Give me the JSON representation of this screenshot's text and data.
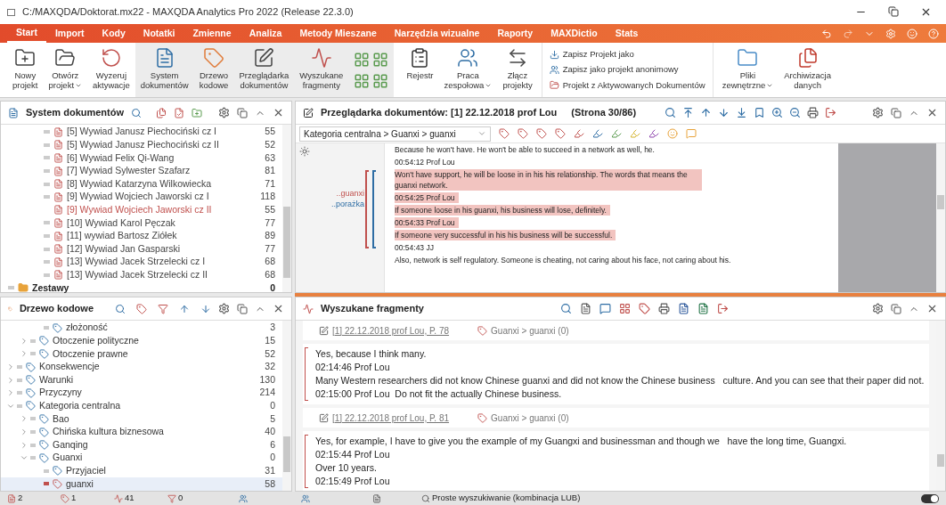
{
  "window": {
    "title": "C:/MAXQDA/Doktorat.mx22 - MAXQDA Analytics Pro 2022 (Release 22.3.0)"
  },
  "menu_tabs": [
    {
      "label": "Start",
      "selected": true
    },
    {
      "label": "Import",
      "selected": false
    },
    {
      "label": "Kody",
      "selected": false
    },
    {
      "label": "Notatki",
      "selected": false
    },
    {
      "label": "Zmienne",
      "selected": false
    },
    {
      "label": "Analiza",
      "selected": false
    },
    {
      "label": "Metody Mieszane",
      "selected": false
    },
    {
      "label": "Narzędzia wizualne",
      "selected": false
    },
    {
      "label": "Raporty",
      "selected": false
    },
    {
      "label": "MAXDictio",
      "selected": false
    },
    {
      "label": "Stats",
      "selected": false
    }
  ],
  "ribbon": [
    {
      "kind": "big",
      "label": "Nowy\nprojekt",
      "on": false,
      "dropdown": false
    },
    {
      "kind": "big",
      "label": "Otwórz\nprojekt",
      "on": false,
      "dropdown": true
    },
    {
      "kind": "big",
      "label": "Wyzeruj\naktywacje",
      "on": false,
      "dropdown": false
    },
    {
      "kind": "big",
      "label": "System\ndokumentów",
      "on": true,
      "dropdown": false
    },
    {
      "kind": "big",
      "label": "Drzewo\nkodowe",
      "on": true,
      "dropdown": false
    },
    {
      "kind": "big",
      "label": "Przeglądarka\ndokumentów",
      "on": true,
      "dropdown": false
    },
    {
      "kind": "big",
      "label": "Wyszukane\nfragmenty",
      "on": true,
      "dropdown": false
    },
    {
      "kind": "layout"
    },
    {
      "kind": "big",
      "label": "Rejestr",
      "on": false,
      "dropdown": false
    },
    {
      "kind": "big",
      "label": "Praca\nzespołowa",
      "on": false,
      "dropdown": true
    },
    {
      "kind": "big",
      "label": "Złącz\nprojekty",
      "on": false,
      "dropdown": false
    },
    {
      "kind": "stack",
      "items": [
        "Zapisz Projekt jako",
        "Zapisz jako projekt anonimowy",
        "Projekt z Aktywowanych Dokumentów"
      ]
    },
    {
      "kind": "big",
      "label": "Pliki\nzewnętrzne",
      "on": false,
      "dropdown": true
    },
    {
      "kind": "big",
      "label": "Archiwizacja\ndanych",
      "on": false,
      "dropdown": false
    }
  ],
  "document_system": {
    "title": "System dokumentów",
    "tree": [
      {
        "children": [
          {
            "children": [
              {
                "label": "[5] Wywiad Janusz Piechociński cz I",
                "count": "55",
                "selected": false
              },
              {
                "label": "[5] Wywiad Janusz Piechociński cz II",
                "count": "52",
                "selected": false
              },
              {
                "label": "[6] Wywiad Felix Qi-Wang",
                "count": "63",
                "selected": false
              },
              {
                "label": "[7] Wywiad Sylwester Szafarz",
                "count": "81",
                "selected": false
              },
              {
                "label": "[8] Wywiad Katarzyna Wilkowiecka",
                "count": "71",
                "selected": false
              },
              {
                "label": "[9] Wywiad Wojciech Jaworski cz I",
                "count": "118",
                "selected": false
              },
              {
                "label": "[9] Wywiad Wojciech Jaworski cz II",
                "count": "55",
                "selected": true
              },
              {
                "label": "[10] Wywiad Karol Pęczak",
                "count": "77",
                "selected": false
              },
              {
                "label": "[11] wywiad Bartosz Ziółek",
                "count": "89",
                "selected": false
              },
              {
                "label": "[12] Wywiad Jan Gasparski",
                "count": "77",
                "selected": false
              },
              {
                "label": "[13] Wywiad Jacek Strzelecki cz I",
                "count": "68",
                "selected": false
              },
              {
                "label": "[13] Wywiad Jacek Strzelecki  cz II",
                "count": "68",
                "selected": false
              }
            ]
          }
        ]
      },
      {
        "label": "Zestawy",
        "count": "0",
        "kind": "sets"
      }
    ]
  },
  "code_system": {
    "title": "Drzewo kodowe",
    "tree": [
      {
        "children": [
          {
            "children": [
              {
                "label": "złożoność",
                "count": "3"
              }
            ]
          },
          {
            "label": "Otoczenie polityczne",
            "count": "15",
            "expanded": false
          },
          {
            "label": "Otoczenie prawne",
            "count": "52",
            "expanded": false
          }
        ]
      },
      {
        "label": "Konsekwencje",
        "count": "32",
        "expanded": false
      },
      {
        "label": "Warunki",
        "count": "130",
        "expanded": false
      },
      {
        "label": "Przyczyny",
        "count": "214",
        "expanded": false
      },
      {
        "label": "Kategoria centralna",
        "count": "0",
        "expanded": true,
        "children": [
          {
            "label": "Bao",
            "count": "5",
            "expanded": false
          },
          {
            "label": "Chińska kultura biznesowa",
            "count": "40",
            "expanded": false
          },
          {
            "label": "Ganqing",
            "count": "6",
            "expanded": false
          },
          {
            "label": "Guanxi",
            "count": "0",
            "expanded": true,
            "children": [
              {
                "label": "Przyjaciel",
                "count": "31",
                "selected": false
              },
              {
                "label": "guanxi",
                "count": "58",
                "selected": true
              }
            ]
          }
        ]
      }
    ]
  },
  "document_browser": {
    "title": "Przeglądarka dokumentów: [1] 22.12.2018 prof Lou",
    "page": "(Strona 30/86)",
    "code_path": "Kategoria centralna > Guanxi > guanxi",
    "margin_codes": [
      {
        "label": "..guanxi",
        "color": "#c0504d"
      },
      {
        "label": "..porażka",
        "color": "#2e6da4"
      }
    ],
    "paragraphs": [
      {
        "text": "Because he won't have. He won't be able to succeed in a network as well, he.",
        "coded": false
      },
      {
        "text": "00:54:12 Prof Lou",
        "coded": false
      },
      {
        "text": "Won't have support, he will be loose in in his his relationship. The words that means the guanxi network.",
        "coded": true
      },
      {
        "text": "00:54:25 Prof Lou",
        "coded": true
      },
      {
        "text": "If someone loose in his guanxi, his business will lose, definitely.",
        "coded": true
      },
      {
        "text": "00:54:33 Prof Lou",
        "coded": true
      },
      {
        "text": "If someone very successful in his his business will be successful.",
        "coded": true
      },
      {
        "text": "00:54:43 JJ",
        "coded": false
      },
      {
        "text": "Also, network is self regulatory. Someone is cheating, not caring about his face, not caring about his.",
        "coded": false
      }
    ]
  },
  "retrieved_segments": {
    "title": "Wyszukane fragmenty",
    "segments": [
      {
        "source": "[1] 22.12.2018 prof Lou, P. 78",
        "code": "Guanxi > guanxi (0)",
        "lines": [
          "Yes, because I think many.",
          "02:14:46 Prof Lou",
          "Many Western researchers did not know Chinese guanxi and did not know the Chinese business   culture. And you can see that their paper did not.",
          "02:15:00 Prof Lou  Do not fit the actually Chinese business."
        ]
      },
      {
        "source": "[1] 22.12.2018 prof Lou, P. 81",
        "code": "Guanxi > guanxi (0)",
        "lines": [
          "Yes, for example, I have to give you the example of my Guangxi and businessman and though we   have the long time, Guangxi.",
          "02:15:44 Prof Lou",
          "Over 10 years.",
          "02:15:49 Prof Lou"
        ]
      }
    ]
  },
  "status_bar": {
    "counts": [
      {
        "kind": "documents",
        "value": "2"
      },
      {
        "kind": "codes",
        "value": "1"
      },
      {
        "kind": "segments",
        "value": "41"
      },
      {
        "kind": "weights",
        "value": "0"
      }
    ],
    "search_mode": "Proste wyszukiwanie (kombinacja LUB)",
    "theme_toggle": {
      "on": true
    }
  }
}
